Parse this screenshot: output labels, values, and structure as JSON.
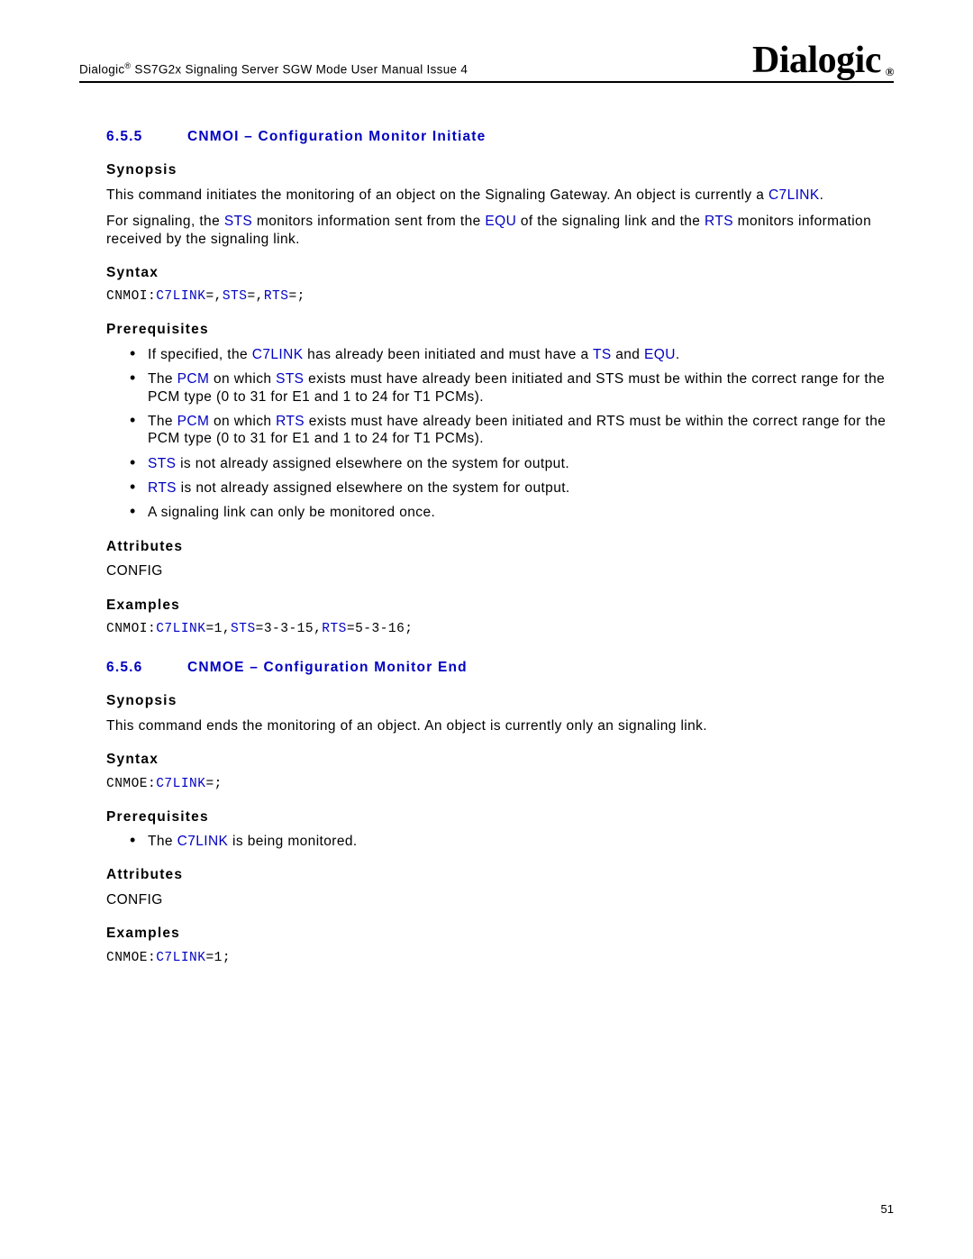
{
  "header": {
    "brand": "Dialogic",
    "reg": "®",
    "doc_title_pre": "Dialogic",
    "doc_title_post": " SS7G2x Signaling Server SGW Mode User Manual Issue 4"
  },
  "section655": {
    "num": "6.5.5",
    "title": "CNMOI – Configuration Monitor Initiate",
    "synopsis_label": "Synopsis",
    "synopsis_p1a": "This command initiates the monitoring of an object on the Signaling Gateway. An object is currently a ",
    "synopsis_p1_link": "C7LINK",
    "synopsis_p1b": ".",
    "synopsis_p2a": "For signaling, the ",
    "synopsis_p2_sts": "STS",
    "synopsis_p2b": " monitors information sent from the ",
    "synopsis_p2_equ": "EQU",
    "synopsis_p2c": " of the signaling link and the ",
    "synopsis_p2_rts": "RTS",
    "synopsis_p2d": " monitors information received by the signaling link.",
    "syntax_label": "Syntax",
    "syntax_code_pre": "CNMOI:",
    "syntax_code_c7": "C7LINK",
    "syntax_code_m1": "=,",
    "syntax_code_sts": "STS",
    "syntax_code_m2": "=,",
    "syntax_code_rts": "RTS",
    "syntax_code_end": "=;",
    "prereq_label": "Prerequisites",
    "prereq": {
      "li1a": "If specified, the ",
      "li1_c7": "C7LINK",
      "li1b": " has already been initiated and must have a ",
      "li1_ts": "TS",
      "li1c": " and ",
      "li1_equ": "EQU",
      "li1d": ".",
      "li2a": "The ",
      "li2_pcm": "PCM",
      "li2b": " on which ",
      "li2_sts": "STS",
      "li2c": " exists must have already been initiated and STS must be within the correct range for the PCM type (0 to 31 for E1 and 1 to 24 for T1 PCMs).",
      "li3a": "The ",
      "li3_pcm": "PCM",
      "li3b": " on which ",
      "li3_rts": "RTS",
      "li3c": " exists must have already been initiated and RTS must be within the correct range for the PCM type (0 to 31 for E1 and 1 to 24 for T1 PCMs).",
      "li4_sts": "STS",
      "li4": " is not already assigned elsewhere on the system for output.",
      "li5_rts": "RTS",
      "li5": " is not already assigned elsewhere on the system for output.",
      "li6": "A signaling link can only be monitored once."
    },
    "attr_label": "Attributes",
    "attr_value": "CONFIG",
    "examples_label": "Examples",
    "ex_code_pre": "CNMOI:",
    "ex_code_c7": "C7LINK",
    "ex_code_m1": "=1,",
    "ex_code_sts": "STS",
    "ex_code_m2": "=3-3-15,",
    "ex_code_rts": "RTS",
    "ex_code_end": "=5-3-16;"
  },
  "section656": {
    "num": "6.5.6",
    "title": "CNMOE – Configuration Monitor End",
    "synopsis_label": "Synopsis",
    "synopsis_p1": "This command ends the monitoring of an object. An object is currently only an signaling link.",
    "syntax_label": "Syntax",
    "syntax_code_pre": "CNMOE:",
    "syntax_code_c7": "C7LINK",
    "syntax_code_end": "=;",
    "prereq_label": "Prerequisites",
    "prereq_li1a": "The ",
    "prereq_li1_c7": "C7LINK",
    "prereq_li1b": " is being monitored.",
    "attr_label": "Attributes",
    "attr_value": "CONFIG",
    "examples_label": "Examples",
    "ex_code_pre": "CNMOE:",
    "ex_code_c7": "C7LINK",
    "ex_code_end": "=1;"
  },
  "page_number": "51"
}
